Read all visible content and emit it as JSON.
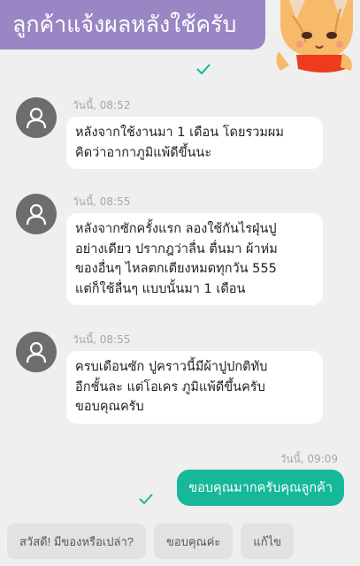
{
  "header": {
    "title": "ลูกค้าแจ้งผลหลังใช้ครับ",
    "mascot_icon": "cartoon-cat-icon",
    "accent_color": "#9a86c4"
  },
  "messages": [
    {
      "time": "วันนี้, 08:52",
      "lines": [
        "หลังจากใช้งานมา 1 เดือน โดยรวมผม",
        "คิดว่าอากาภูมิแพ้ดีขึ้นนะ"
      ]
    },
    {
      "time": "วันนี้, 08:55",
      "lines": [
        "หลังจากซักครั้งแรก ลองใช้กันไรฝุ่นปู",
        "อย่างเดียว ปรากฎว่าลื่น ตื่นมา ผ้าห่ม",
        "ของอื่นๆ ไหลตกเตียงหมดทุกวัน 555",
        "แต่ก็ใช้ลื่นๆ แบบนั้นมา 1 เดือน"
      ]
    },
    {
      "time": "วันนี้, 08:55",
      "lines": [
        "ครบเดือนซัก ปูคราวนี้มีผ้าปูปกติทับ",
        "อีกชั้นละ แต่โอเคร ภูมิแพ้ดีขึ้นครับ",
        "ขอบคุณครับ"
      ]
    }
  ],
  "outgoing": {
    "time": "วันนี้, 09:09",
    "text": "ขอบคุณมากครับคุณลูกค้า",
    "color": "#17b79a"
  },
  "quick_replies": [
    "สวัสดี! มีของหรือเปล่า?",
    "ขอบคุณค่ะ",
    "แก้ไข"
  ]
}
